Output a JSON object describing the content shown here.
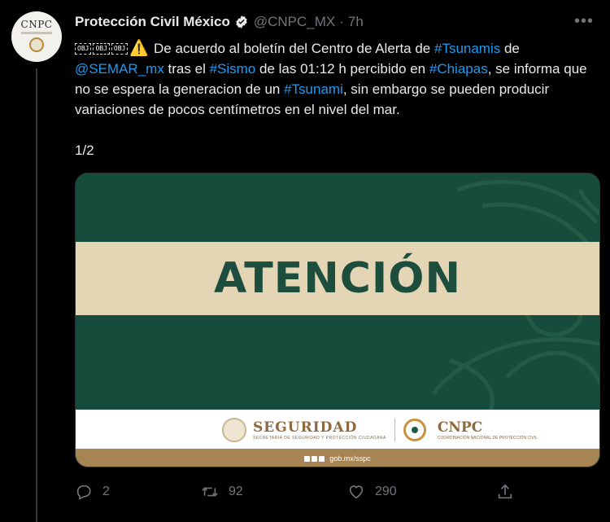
{
  "account": {
    "name": "Protección Civil México",
    "handle": "@CNPC_MX",
    "separator": "·",
    "time": "7h",
    "avatar_text": "CNPC"
  },
  "tweet": {
    "obj_chars": [
      "OBJ",
      "OBJ",
      "OBJ"
    ],
    "warning_icon": "⚠️",
    "segments": [
      {
        "text": "De acuerdo al boletín del Centro de Alerta de ",
        "link": false
      },
      {
        "text": "#Tsunamis",
        "link": true
      },
      {
        "text": " de ",
        "link": false
      },
      {
        "text": "@SEMAR_mx",
        "link": true
      },
      {
        "text": " tras el ",
        "link": false
      },
      {
        "text": "#Sismo",
        "link": true
      },
      {
        "text": " de las 01:12 h percibido en ",
        "link": false
      },
      {
        "text": "#Chiapas",
        "link": true
      },
      {
        "text": ", se informa que no se espera la generacion de un ",
        "link": false
      },
      {
        "text": "#Tsunami",
        "link": true
      },
      {
        "text": ", sin embargo se pueden producir variaciones de pocos centímetros en el nivel del mar.",
        "link": false
      }
    ],
    "thread_count": "1/2"
  },
  "media": {
    "headline": "ATENCIÓN",
    "logo1_name": "SEGURIDAD",
    "logo1_sub": "SECRETARÍA DE SEGURIDAD Y PROTECCIÓN CIUDADANA",
    "logo2_name": "CNPC",
    "logo2_sub": "COORDINACIÓN NACIONAL DE PROTECCIÓN CIVIL",
    "footer_url": "gob.mx/sspc"
  },
  "actions": {
    "replies": "2",
    "retweets": "92",
    "likes": "290"
  },
  "colors": {
    "link": "#1d9bf0",
    "muted": "#71767b",
    "green": "#164c3b",
    "band": "#e4d5b5",
    "gold": "#a78454"
  }
}
